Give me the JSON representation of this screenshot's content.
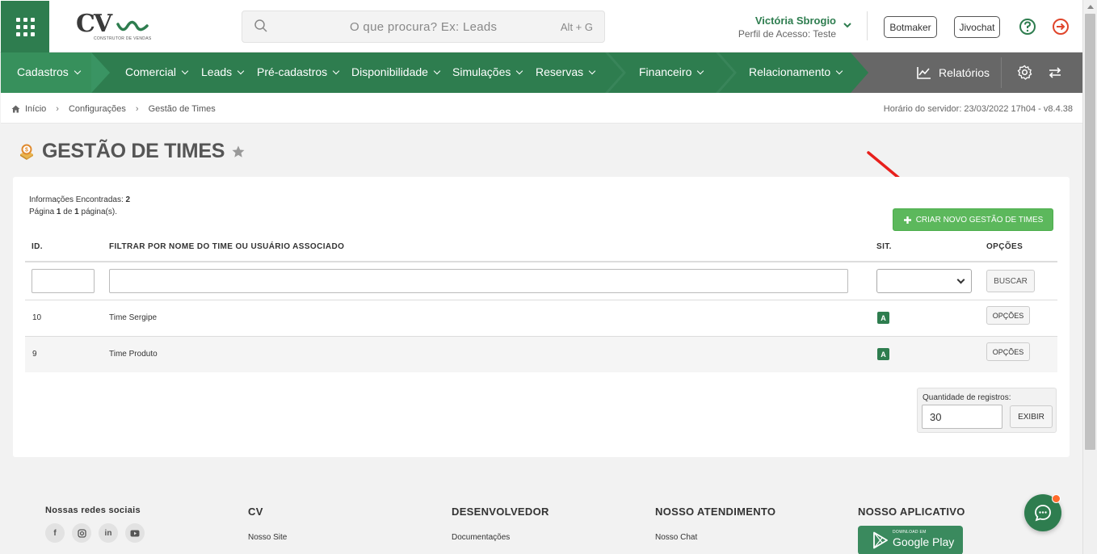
{
  "header": {
    "logo_text": "CV",
    "logo_subtitle": "CONSTRUTOR DE VENDAS",
    "search_placeholder": "O que procura? Ex: Leads",
    "search_hotkey": "Alt + G",
    "user_name": "Victória Sbrogio",
    "user_profile": "Perfil de Acesso: Teste",
    "botmaker_label": "Botmaker",
    "jivochat_label": "Jivochat"
  },
  "nav": {
    "items": [
      {
        "label": "Cadastros"
      },
      {
        "label": "Comercial"
      },
      {
        "label": "Leads"
      },
      {
        "label": "Pré-cadastros"
      },
      {
        "label": "Disponibilidade"
      },
      {
        "label": "Simulações"
      },
      {
        "label": "Reservas"
      },
      {
        "label": "Financeiro"
      },
      {
        "label": "Relacionamento"
      }
    ],
    "reports_label": "Relatórios"
  },
  "breadcrumb": {
    "items": [
      "Início",
      "Configurações",
      "Gestão de Times"
    ],
    "server_time": "Horário do servidor: 23/03/2022 17h04 - v8.4.38"
  },
  "page": {
    "title": "GESTÃO DE TIMES",
    "info_found_label": "Informações Encontradas:",
    "info_found_count": "2",
    "page_prefix": "Página",
    "page_current": "1",
    "page_of": "de",
    "page_total": "1",
    "page_suffix": "página(s).",
    "create_button": "CRIAR NOVO GESTÃO DE TIMES"
  },
  "table": {
    "headers": {
      "id": "ID.",
      "name": "FILTRAR POR NOME DO TIME OU USUÁRIO ASSOCIADO",
      "status": "SIT.",
      "options": "OPÇÕES"
    },
    "search_button": "BUSCAR",
    "rows": [
      {
        "id": "10",
        "name": "Time Sergipe",
        "status": "A",
        "options": "OPÇÕES"
      },
      {
        "id": "9",
        "name": "Time Produto",
        "status": "A",
        "options": "OPÇÕES"
      }
    ],
    "qty_label": "Quantidade de registros:",
    "qty_value": "30",
    "show_button": "EXIBIR"
  },
  "footer": {
    "social_title": "Nossas redes sociais",
    "cv_title": "CV",
    "cv_link": "Nosso Site",
    "dev_title": "DESENVOLVEDOR",
    "dev_link": "Documentações",
    "support_title": "NOSSO ATENDIMENTO",
    "support_link": "Nosso Chat",
    "app_title": "NOSSO APLICATIVO",
    "gplay_small": "DOWNLOAD EM",
    "gplay_big": "Google Play"
  },
  "colors": {
    "brand_green": "#2e7d4f",
    "button_green": "#5cb85c",
    "nav_gray": "#676767",
    "logout_red": "#e0452b"
  }
}
